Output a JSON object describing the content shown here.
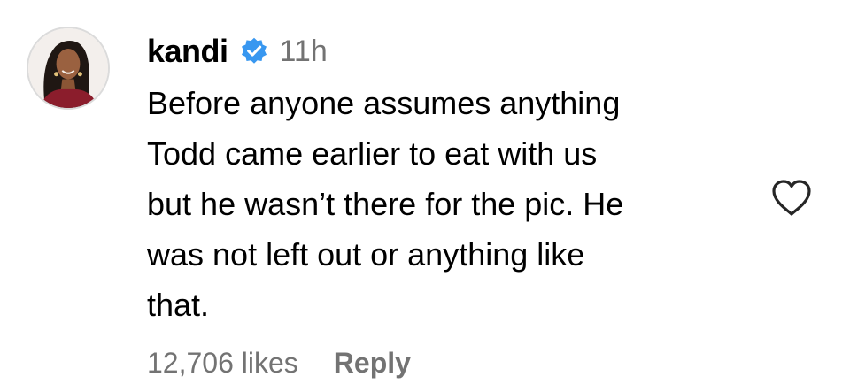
{
  "comment": {
    "username": "kandi",
    "verified_icon": "verified-badge-icon",
    "verified_color": "#3897f0",
    "time_ago": "11h",
    "text_lines": [
      "Before anyone assumes anything",
      "Todd came earlier to eat with us",
      "but he wasn’t there for the pic. He",
      "was not left out or anything like",
      "that."
    ],
    "likes": "12,706 likes",
    "reply_label": "Reply",
    "like_icon": "heart-outline-icon"
  }
}
